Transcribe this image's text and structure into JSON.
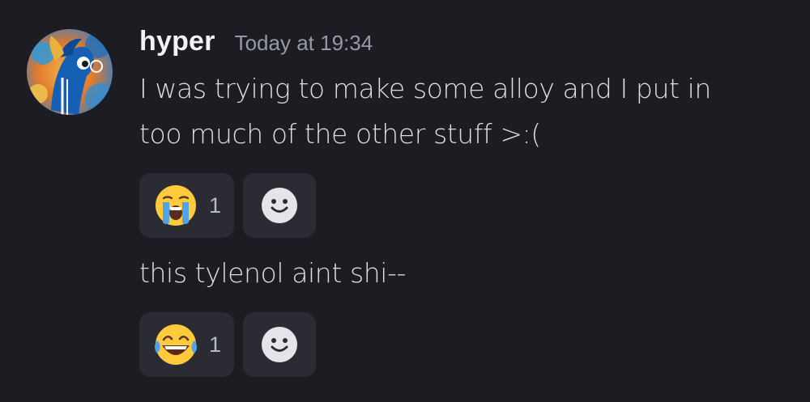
{
  "author": {
    "username": "hyper",
    "timestamp": "Today at 19:34",
    "avatar_icon": "pony-avatar-icon"
  },
  "messages": [
    {
      "text_line1": "I was trying to make some alloy and I put in",
      "text_line2": "too much of the other stuff >:(",
      "reaction": {
        "emoji": "loudly-crying-face",
        "count": "1"
      }
    },
    {
      "text": "this tylenol aint shi--",
      "reaction": {
        "emoji": "face-with-tears-of-joy",
        "count": "1"
      }
    }
  ],
  "colors": {
    "background": "#1c1c22",
    "reaction_bg": "#2b2c33",
    "username": "#f2f3f5",
    "timestamp": "#949ba4",
    "message": "#dbdee1"
  }
}
